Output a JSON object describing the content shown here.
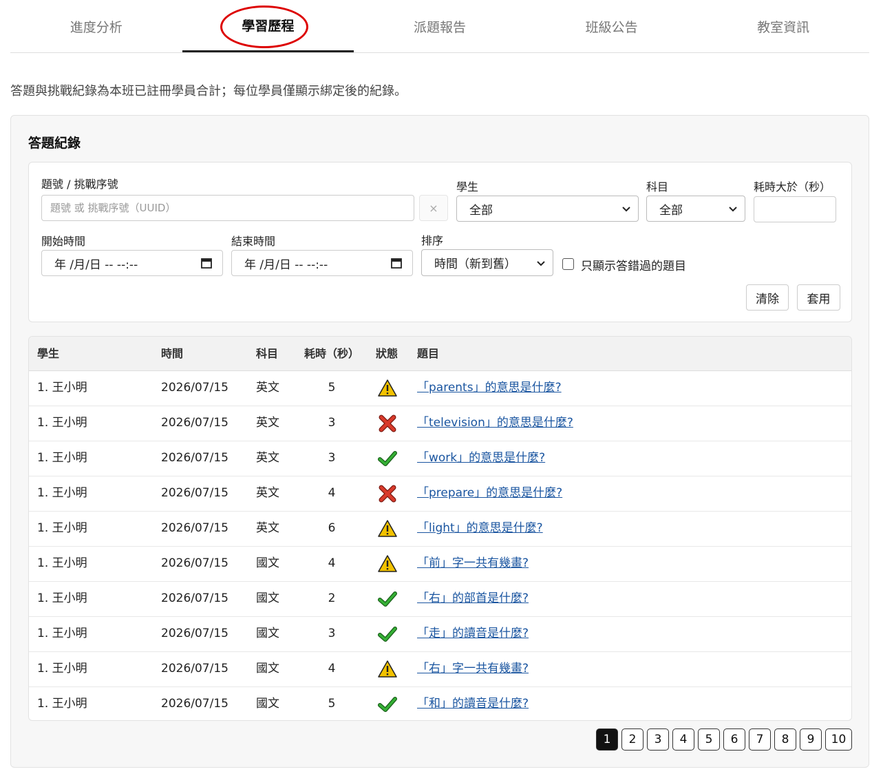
{
  "tabs": [
    {
      "label": "進度分析",
      "active": false
    },
    {
      "label": "學習歷程",
      "active": true
    },
    {
      "label": "派題報告",
      "active": false
    },
    {
      "label": "班級公告",
      "active": false
    },
    {
      "label": "教室資訊",
      "active": false
    }
  ],
  "note": "答題與挑戰紀錄為本班已註冊學員合計；每位學員僅顯示綁定後的紀錄。",
  "section_title": "答題紀錄",
  "filters": {
    "id_label": "題號 / 挑戰序號",
    "id_placeholder": "題號 或 挑戰序號（UUID）",
    "clear_x": "×",
    "student_label": "學生",
    "student_value": "全部",
    "subject_label": "科目",
    "subject_value": "全部",
    "duration_label": "耗時大於（秒）",
    "duration_value": "",
    "start_label": "開始時間",
    "start_value": "年 /月/日 -- --:--",
    "end_label": "結束時間",
    "end_value": "年 /月/日 -- --:--",
    "sort_label": "排序",
    "sort_value": "時間（新到舊）",
    "wrong_only_label": "只顯示答錯過的題目",
    "wrong_only_checked": false,
    "clear_button": "清除",
    "apply_button": "套用"
  },
  "table": {
    "headers": {
      "student": "學生",
      "time": "時間",
      "subject": "科目",
      "duration": "耗時（秒）",
      "status": "狀態",
      "question": "題目"
    },
    "rows": [
      {
        "student": "1. 王小明",
        "date": "2026/07/15",
        "subject": "英文",
        "seconds": "5",
        "status": "warning",
        "question": "「parents」的意思是什麼?"
      },
      {
        "student": "1. 王小明",
        "date": "2026/07/15",
        "subject": "英文",
        "seconds": "3",
        "status": "wrong",
        "question": "「television」的意思是什麼?"
      },
      {
        "student": "1. 王小明",
        "date": "2026/07/15",
        "subject": "英文",
        "seconds": "3",
        "status": "correct",
        "question": "「work」的意思是什麼?"
      },
      {
        "student": "1. 王小明",
        "date": "2026/07/15",
        "subject": "英文",
        "seconds": "4",
        "status": "wrong",
        "question": "「prepare」的意思是什麼?"
      },
      {
        "student": "1. 王小明",
        "date": "2026/07/15",
        "subject": "英文",
        "seconds": "6",
        "status": "warning",
        "question": "「light」的意思是什麼?"
      },
      {
        "student": "1. 王小明",
        "date": "2026/07/15",
        "subject": "國文",
        "seconds": "4",
        "status": "warning",
        "question": "「前」字一共有幾畫?"
      },
      {
        "student": "1. 王小明",
        "date": "2026/07/15",
        "subject": "國文",
        "seconds": "2",
        "status": "correct",
        "question": "「右」的部首是什麼?"
      },
      {
        "student": "1. 王小明",
        "date": "2026/07/15",
        "subject": "國文",
        "seconds": "3",
        "status": "correct",
        "question": "「走」的讀音是什麼?"
      },
      {
        "student": "1. 王小明",
        "date": "2026/07/15",
        "subject": "國文",
        "seconds": "4",
        "status": "warning",
        "question": "「右」字一共有幾畫?"
      },
      {
        "student": "1. 王小明",
        "date": "2026/07/15",
        "subject": "國文",
        "seconds": "5",
        "status": "correct",
        "question": "「和」的讀音是什麼?"
      }
    ]
  },
  "pagination": {
    "pages": [
      "1",
      "2",
      "3",
      "4",
      "5",
      "6",
      "7",
      "8",
      "9",
      "10"
    ],
    "current": "1"
  },
  "colors": {
    "accent_circle": "#dd0000",
    "link": "#1a55a0",
    "correct": "#2e9e2e",
    "wrong": "#d93a2b",
    "warning": "#f2c200"
  }
}
